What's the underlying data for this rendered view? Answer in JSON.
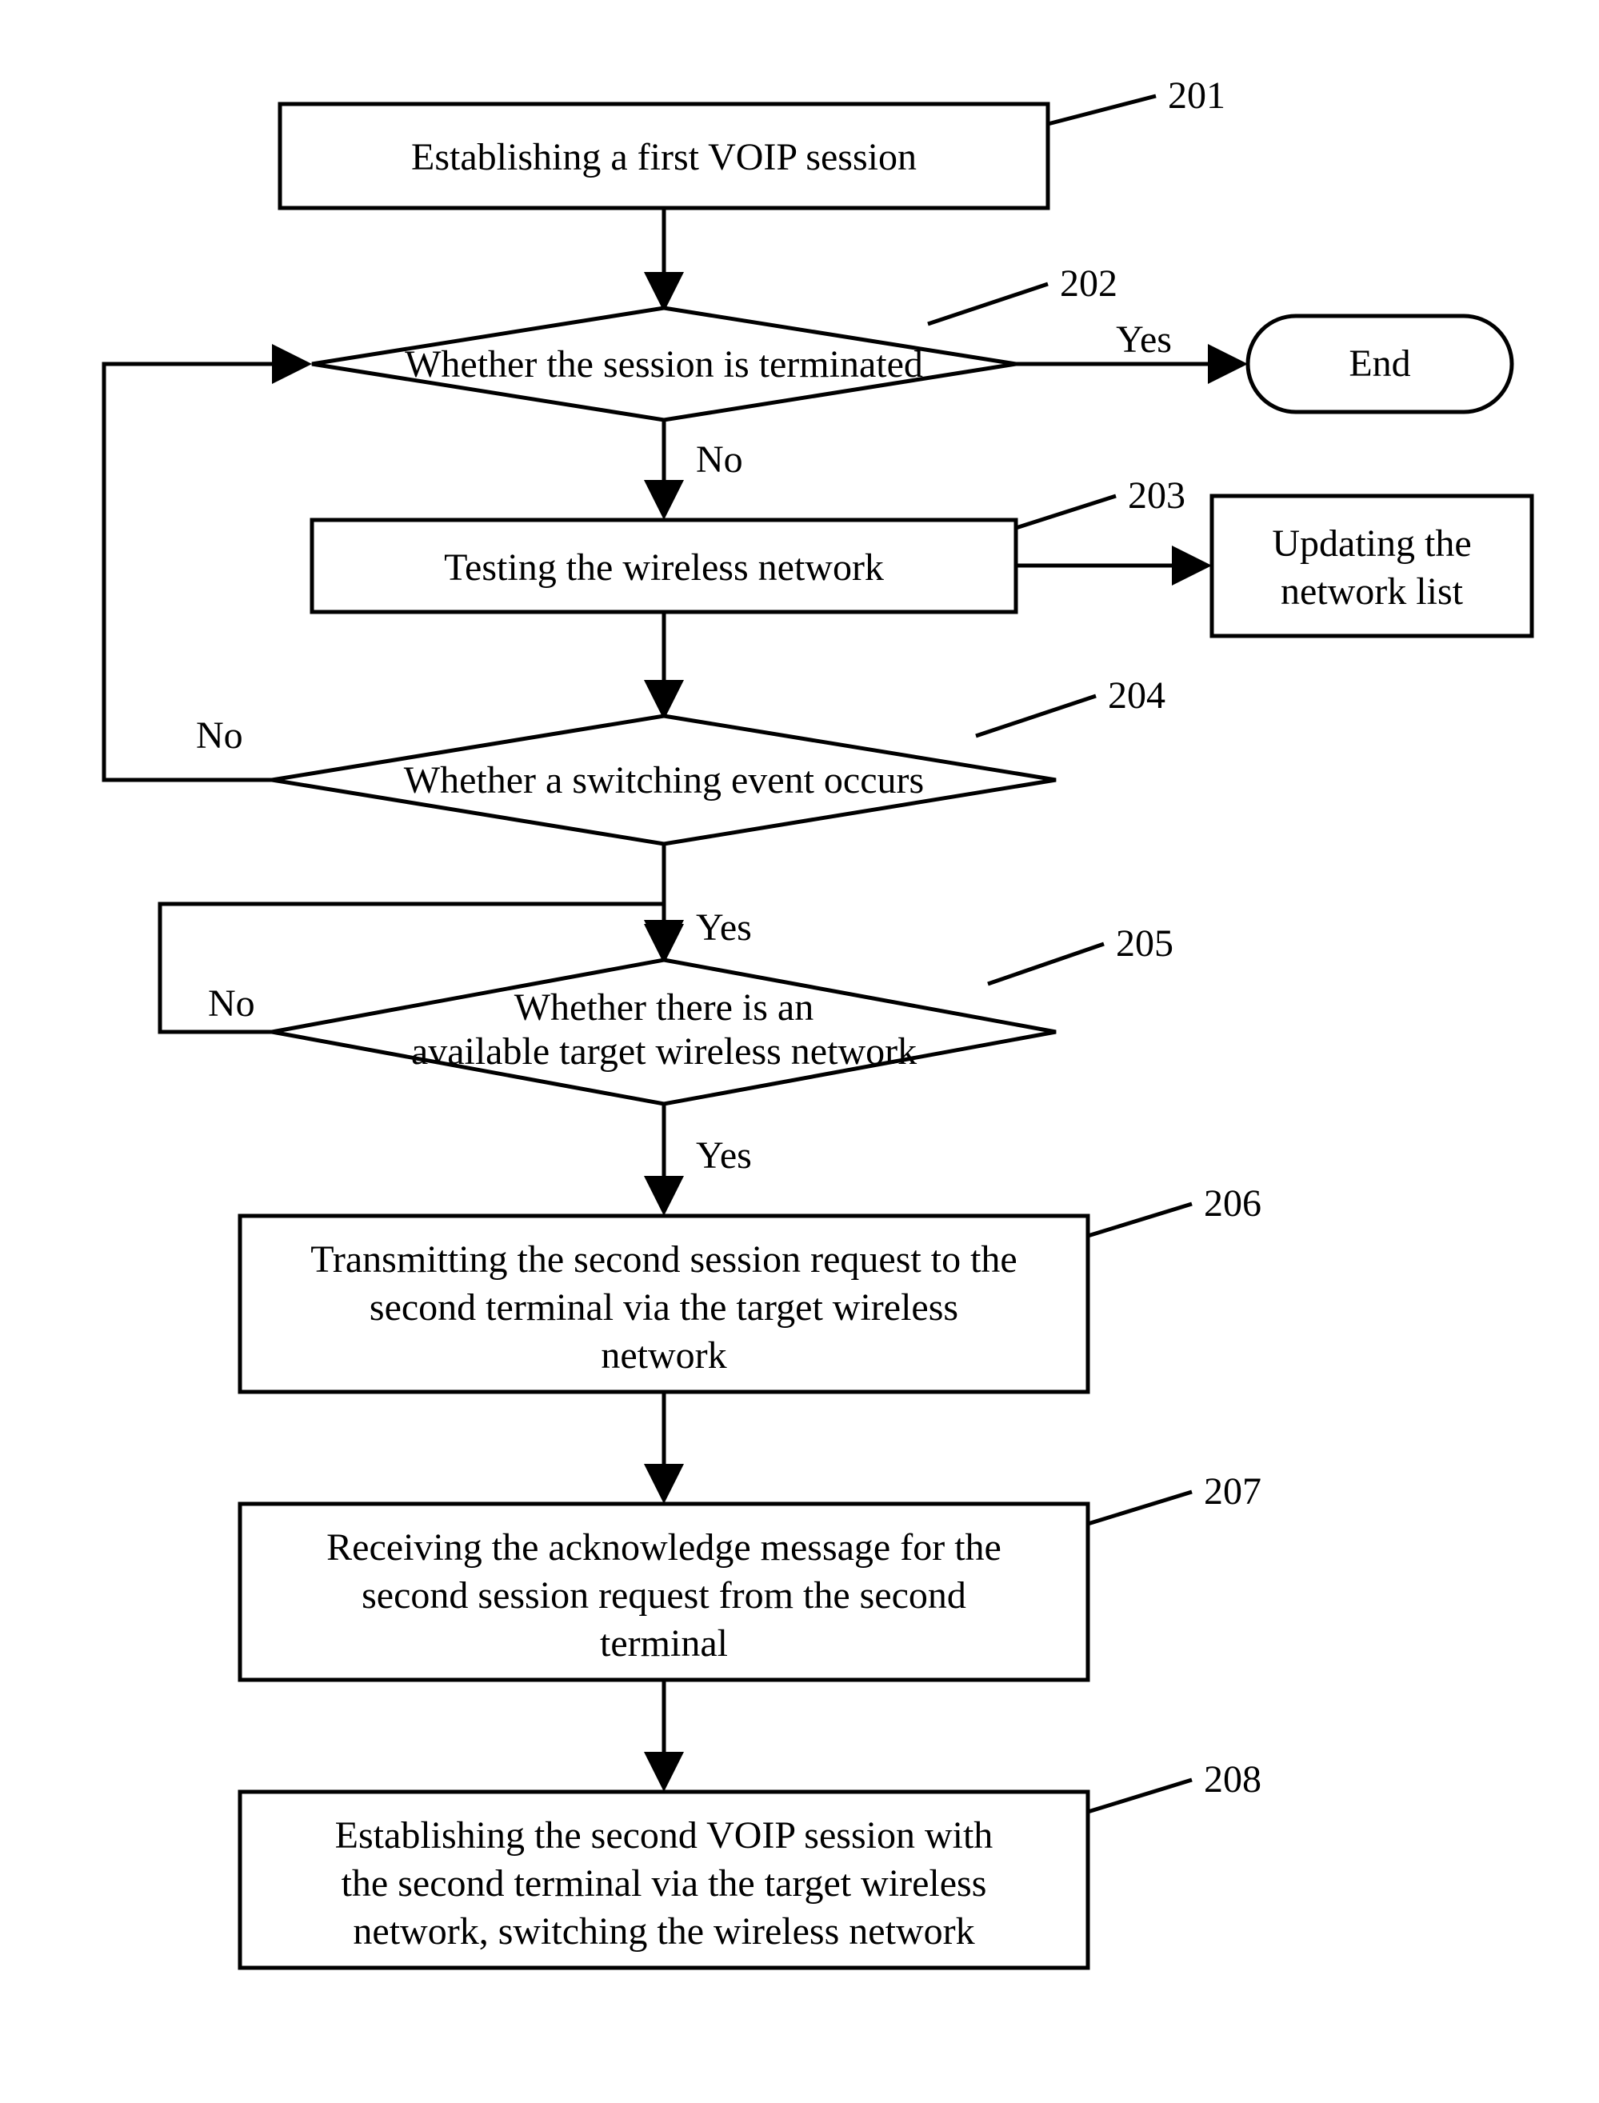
{
  "chart_data": {
    "type": "flowchart",
    "nodes": [
      {
        "id": "201",
        "kind": "process",
        "text": "Establishing a first VOIP session"
      },
      {
        "id": "202",
        "kind": "decision",
        "text": "Whether the session is terminated"
      },
      {
        "id": "END",
        "kind": "terminator",
        "text": "End"
      },
      {
        "id": "203",
        "kind": "process",
        "text": "Testing the wireless network"
      },
      {
        "id": "UPD",
        "kind": "process",
        "text": "Updating the network list"
      },
      {
        "id": "204",
        "kind": "decision",
        "text": "Whether a switching event occurs"
      },
      {
        "id": "205",
        "kind": "decision",
        "text": "Whether there is an available target wireless network"
      },
      {
        "id": "206",
        "kind": "process",
        "text": "Transmitting the second session request to the second terminal via the target wireless network"
      },
      {
        "id": "207",
        "kind": "process",
        "text": "Receiving the acknowledge message for the second session request from the second terminal"
      },
      {
        "id": "208",
        "kind": "process",
        "text": "Establishing the second VOIP session with the second terminal via the target wireless network, switching the wireless network"
      }
    ],
    "edges": [
      {
        "from": "201",
        "to": "202",
        "label": ""
      },
      {
        "from": "202",
        "to": "END",
        "label": "Yes"
      },
      {
        "from": "202",
        "to": "203",
        "label": "No"
      },
      {
        "from": "203",
        "to": "UPD",
        "label": ""
      },
      {
        "from": "203",
        "to": "204",
        "label": ""
      },
      {
        "from": "204",
        "to": "202",
        "label": "No"
      },
      {
        "from": "204",
        "to": "205",
        "label": "Yes"
      },
      {
        "from": "205",
        "to": "205",
        "label": "No"
      },
      {
        "from": "205",
        "to": "206",
        "label": "Yes"
      },
      {
        "from": "206",
        "to": "207",
        "label": ""
      },
      {
        "from": "207",
        "to": "208",
        "label": ""
      }
    ]
  },
  "labels": {
    "yes": "Yes",
    "no": "No",
    "end": "End",
    "ref201": "201",
    "ref202": "202",
    "ref203": "203",
    "ref204": "204",
    "ref205": "205",
    "ref206": "206",
    "ref207": "207",
    "ref208": "208"
  },
  "text": {
    "n201": "Establishing a first VOIP session",
    "n202": "Whether the session is terminated",
    "n203": "Testing the wireless network",
    "upd1": "Updating the",
    "upd2": "network list",
    "n204": "Whether a switching event occurs",
    "n205a": "Whether there is an",
    "n205b": "available target wireless network",
    "n206a": "Transmitting the second session request to the",
    "n206b": "second terminal via the target wireless",
    "n206c": "network",
    "n207a": "Receiving the acknowledge message for the",
    "n207b": "second session request from the second",
    "n207c": "terminal",
    "n208a": "Establishing the second VOIP session with",
    "n208b": "the second terminal via the target wireless",
    "n208c": "network, switching the wireless network"
  }
}
